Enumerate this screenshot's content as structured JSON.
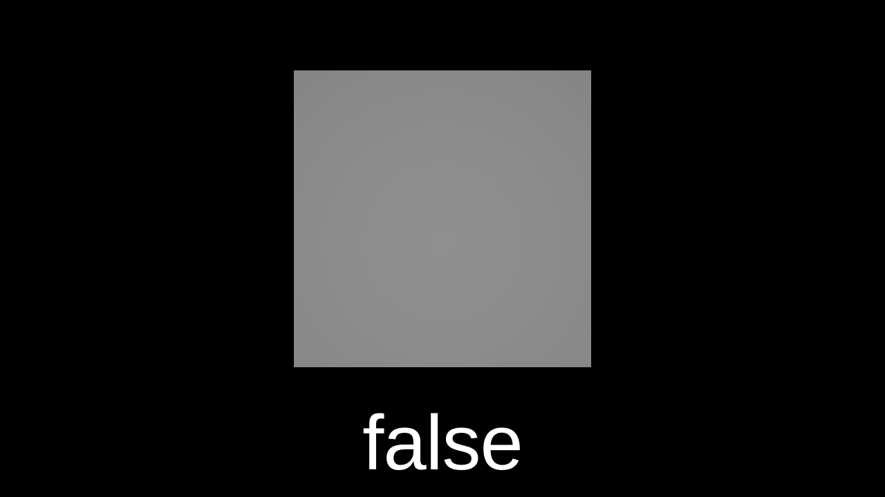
{
  "caption": {
    "text": "false"
  },
  "colors": {
    "background": "#000000",
    "square": "#8c8c8c",
    "caption_text": "#ffffff"
  }
}
